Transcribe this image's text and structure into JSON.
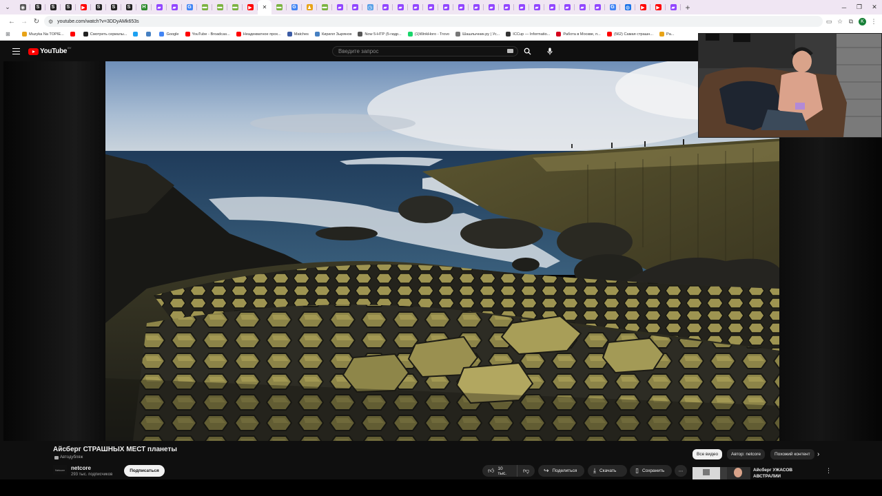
{
  "browser": {
    "url": "youtube.com/watch?v=3DDyAMk653s",
    "tabs": [
      {
        "icon": "chrome-icon",
        "color": "#555555"
      },
      {
        "icon": "s-icon",
        "color": "#222222"
      },
      {
        "icon": "s-icon",
        "color": "#222222"
      },
      {
        "icon": "s-icon",
        "color": "#222222"
      },
      {
        "icon": "youtube-icon",
        "color": "#ff0000"
      },
      {
        "icon": "s-icon",
        "color": "#222222"
      },
      {
        "icon": "s-icon",
        "color": "#222222"
      },
      {
        "icon": "s-icon",
        "color": "#222222"
      },
      {
        "icon": "h-icon",
        "color": "#2e8b2e"
      },
      {
        "icon": "twitch-icon",
        "color": "#9146ff"
      },
      {
        "icon": "twitch-icon",
        "color": "#9146ff"
      },
      {
        "icon": "google-icon",
        "color": "#4285f4"
      },
      {
        "icon": "folder-icon",
        "color": "#7cb342"
      },
      {
        "icon": "folder-icon",
        "color": "#7cb342"
      },
      {
        "icon": "folder-icon",
        "color": "#7cb342"
      },
      {
        "icon": "youtube-icon",
        "color": "#ff0000"
      },
      {
        "icon": "close-icon",
        "color": "#333333",
        "active": true
      },
      {
        "icon": "folder-icon",
        "color": "#7cb342"
      },
      {
        "icon": "google-icon",
        "color": "#4285f4"
      },
      {
        "icon": "person-icon",
        "color": "#e8a317"
      },
      {
        "icon": "folder-icon",
        "color": "#7cb342"
      },
      {
        "icon": "twitch-icon",
        "color": "#9146ff"
      },
      {
        "icon": "twitch-icon",
        "color": "#9146ff"
      },
      {
        "icon": "clock-icon",
        "color": "#5aa0e6"
      },
      {
        "icon": "twitch-icon",
        "color": "#9146ff"
      },
      {
        "icon": "twitch-icon",
        "color": "#9146ff"
      },
      {
        "icon": "twitch-icon",
        "color": "#9146ff"
      },
      {
        "icon": "twitch-icon",
        "color": "#9146ff"
      },
      {
        "icon": "twitch-icon",
        "color": "#9146ff"
      },
      {
        "icon": "twitch-icon",
        "color": "#9146ff"
      },
      {
        "icon": "twitch-icon",
        "color": "#9146ff"
      },
      {
        "icon": "twitch-icon",
        "color": "#9146ff"
      },
      {
        "icon": "twitch-icon",
        "color": "#9146ff"
      },
      {
        "icon": "twitch-icon",
        "color": "#9146ff"
      },
      {
        "icon": "twitch-icon",
        "color": "#9146ff"
      },
      {
        "icon": "twitch-icon",
        "color": "#9146ff"
      },
      {
        "icon": "twitch-icon",
        "color": "#9146ff"
      },
      {
        "icon": "twitch-icon",
        "color": "#9146ff"
      },
      {
        "icon": "twitch-icon",
        "color": "#9146ff"
      },
      {
        "icon": "google-icon",
        "color": "#4285f4"
      },
      {
        "icon": "globe-icon",
        "color": "#1a73e8"
      },
      {
        "icon": "youtube-icon",
        "color": "#ff0000"
      },
      {
        "icon": "youtube-icon",
        "color": "#ff0000"
      },
      {
        "icon": "twitch-icon",
        "color": "#9146ff"
      }
    ],
    "new_tab": "+",
    "profile_initial": "K"
  },
  "bookmarks": [
    {
      "label": "Muzyka Na TOPIE...",
      "color": "#e8a317"
    },
    {
      "label": "",
      "color": "#ff0000"
    },
    {
      "label": "Смотреть сериалы...",
      "color": "#222222"
    },
    {
      "label": "",
      "color": "#1da1f2"
    },
    {
      "label": "",
      "color": "#4680c2"
    },
    {
      "label": "Google",
      "color": "#4285f4"
    },
    {
      "label": "YouTube - Broadcas...",
      "color": "#ff0000"
    },
    {
      "label": "Неадекватное прох...",
      "color": "#ff0000"
    },
    {
      "label": "Matches",
      "color": "#3b5ba5"
    },
    {
      "label": "Кирилл Зырянов",
      "color": "#4680c2"
    },
    {
      "label": "Now 5-HTP (5-гидр...",
      "color": "#555555"
    },
    {
      "label": "(1)WinkHoro - Trovo",
      "color": "#19d66b"
    },
    {
      "label": "Шашлычник.ру | Ус...",
      "color": "#777777"
    },
    {
      "label": "ICCup — Informatio...",
      "color": "#333333"
    },
    {
      "label": "Работа в Москве, п...",
      "color": "#d6001c"
    },
    {
      "label": "(562) Самая страшн...",
      "color": "#ff0000"
    },
    {
      "label": "Pa...",
      "color": "#e8a317"
    }
  ],
  "youtube": {
    "logo_text": "YouTube",
    "logo_country": "BY",
    "search_placeholder": "Введите запрос",
    "video_title": "Айсберг СТРАШНЫХ МЕСТ планеты",
    "dubbing_label": "Автодубляж",
    "channel": {
      "avatar_text": "Netcore",
      "name": "netcore",
      "subscribers": "293 тыс. подписчиков",
      "subscribe_label": "Подписаться"
    },
    "actions": {
      "likes": "10 тыс.",
      "share": "Поделиться",
      "download": "Скачать",
      "save": "Сохранить",
      "more": "⋯"
    },
    "chips": {
      "all": "Все видео",
      "author": "Автор: netcore",
      "similar": "Похожий контент"
    },
    "recommendation": {
      "title": "Айсберг УЖАСОВ АВСТРАЛИИ"
    }
  }
}
